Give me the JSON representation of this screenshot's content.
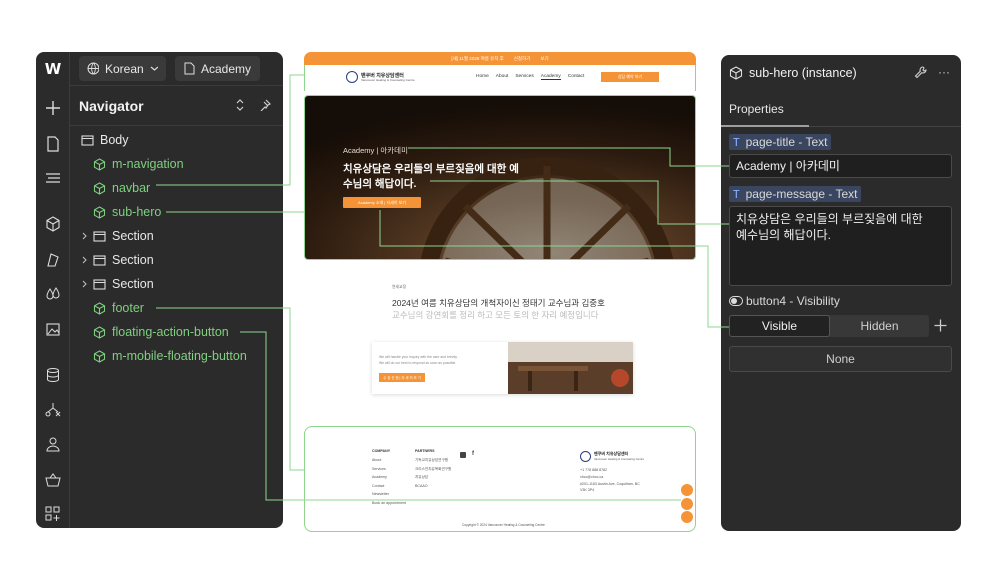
{
  "left_panel": {
    "locale_label": "Korean",
    "page_label": "Academy",
    "navigator_title": "Navigator",
    "sidebar_icons": [
      "add-icon",
      "pages-icon",
      "navigator-icon",
      "components-icon",
      "style-icon",
      "variables-icon",
      "assets-icon",
      "cms-icon",
      "logic-icon",
      "users-icon",
      "ecommerce-icon",
      "apps-icon"
    ],
    "tree": [
      {
        "label": "Body",
        "kind": "element"
      },
      {
        "label": "m-navigation",
        "kind": "component"
      },
      {
        "label": "navbar",
        "kind": "component"
      },
      {
        "label": "sub-hero",
        "kind": "component"
      },
      {
        "label": "Section",
        "kind": "element"
      },
      {
        "label": "Section",
        "kind": "element"
      },
      {
        "label": "Section",
        "kind": "element"
      },
      {
        "label": "footer",
        "kind": "component"
      },
      {
        "label": "floating-action-button",
        "kind": "component"
      },
      {
        "label": "m-mobile-floating-button",
        "kind": "component"
      }
    ]
  },
  "preview": {
    "announcement": "[새] 11월 2026 여름 유치 후",
    "announcement_links": [
      "신청하기",
      "보기"
    ],
    "logo_name": "밴쿠버 치유상담센터",
    "logo_sub": "Vancouver Healing & Counseling Centre",
    "menu": [
      "Home",
      "About",
      "Services",
      "Academy",
      "Contact"
    ],
    "cta": "상담 예약 하기",
    "hero_small": "Academy | 아카데미",
    "hero_message": "치유상담은 우리들의 부르짖음에 대한 예수님의 해답이다.",
    "hero_button": "Academy 소개 | 자세히 보기",
    "section_kicker": "연세교정",
    "section_heading": "2024년 여름 치유상담의 개척자이신 정태기 교수님과 김중호",
    "section_sub": "교수님의 강연회를 정리 하고 모든 토의 한 자리 예정입니다",
    "card_text_1": "We will handle your inquiry with the care and brevity.",
    "card_text_2": "We will do our best to respond as soon as possible.",
    "card_button": "수 강 신 청 | 자 세 히 보 기",
    "footer_company_title": "COMPANY",
    "footer_company": [
      "About",
      "Services",
      "Academy",
      "Contact",
      "Newsletter",
      "Book an appointment"
    ],
    "footer_partners_title": "PARTNERS",
    "footer_partners": [
      "기독교치유상담연구원",
      "크리스천치유목회연구원",
      "치유상담",
      "BCAAO"
    ],
    "footer_phone": "+1 778 888 8782",
    "footer_email": "vhcc@vhcc.ca",
    "footer_address": "#201-1183 Austin Ave, Coquitlam, BC",
    "footer_postal": "V3K 3P4",
    "footer_copyright": "Copyright © 2024 Vancouver Healing & Counseling Centre"
  },
  "right_panel": {
    "title": "sub-hero (instance)",
    "tab": "Properties",
    "prop1_label": "page-title - Text",
    "prop1_value": "Academy | 아카데미",
    "prop2_label": "page-message - Text",
    "prop2_value": "치유상담은 우리들의 부르짖음에 대한\n예수님의 해답이다.",
    "visibility_label": "button4 - Visibility",
    "visible": "Visible",
    "hidden": "Hidden",
    "visibility_state": "Visible",
    "none_label": "None"
  },
  "colors": {
    "panel_bg": "#2b2b2b",
    "component_green": "#7fd07f",
    "brand_orange": "#f59436",
    "connector": "#8fd48f"
  }
}
